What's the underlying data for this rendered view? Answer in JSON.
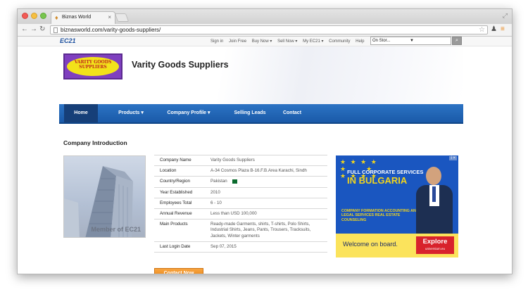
{
  "browser": {
    "tab_title": "Biznas World",
    "tab_close": "×",
    "url": "biznasworld.com/varity-goods-suppliers/"
  },
  "topbar": {
    "logo": "EC21",
    "links": [
      "Sign in",
      "Join Free",
      "Buy Now ▾",
      "Sell Now ▾",
      "My EC21 ▾",
      "Community",
      "Help"
    ],
    "site_select": "On Stor...",
    "search_icon": "search-icon"
  },
  "header": {
    "logo_text_1": "VARITY GOODS",
    "logo_text_2": "SUPPLIERS",
    "company_name": "Varity Goods Suppliers"
  },
  "nav": {
    "home": "Home",
    "products": "Products ▾",
    "profile": "Company Profile ▾",
    "leads": "Selling Leads",
    "contact": "Contact"
  },
  "section": {
    "title": "Company Introduction",
    "image_watermark": "Member of EC21"
  },
  "company": {
    "rows": [
      {
        "label": "Company Name",
        "value": "Varity Goods Suppliers"
      },
      {
        "label": "Location",
        "value": "A-34 Cosmos Plaza B-16.F.B.Area Karachi, Sindh"
      },
      {
        "label": "Country/Region",
        "value": "Pakistan"
      },
      {
        "label": "Year Established",
        "value": "2010"
      },
      {
        "label": "Employees Total",
        "value": "6 - 10"
      },
      {
        "label": "Annual Revenue",
        "value": "Less than USD 100,000"
      },
      {
        "label": "Main Products",
        "value": "Ready-made Garments, shirts, T-shirts, Polo Shirts, Industrial Shirts, Jeans, Pants, Trousers, Tracksuits, Jackets, Winter garments"
      },
      {
        "label": "Last Login Date",
        "value": "Sep 07, 2015"
      }
    ],
    "contact_button": "Contact Now"
  },
  "ad": {
    "line1": "FULL CORPORATE SERVICES",
    "line2": "IN BULGARIA",
    "sub": "COMPANY FORMATION ACCOUNTING AND LEGAL SERVICES REAL ESTATE COUNSELING",
    "welcome": "Welcome on board.",
    "explore": "Explore",
    "explore_url": "universium.eu",
    "badge": "i ×"
  }
}
